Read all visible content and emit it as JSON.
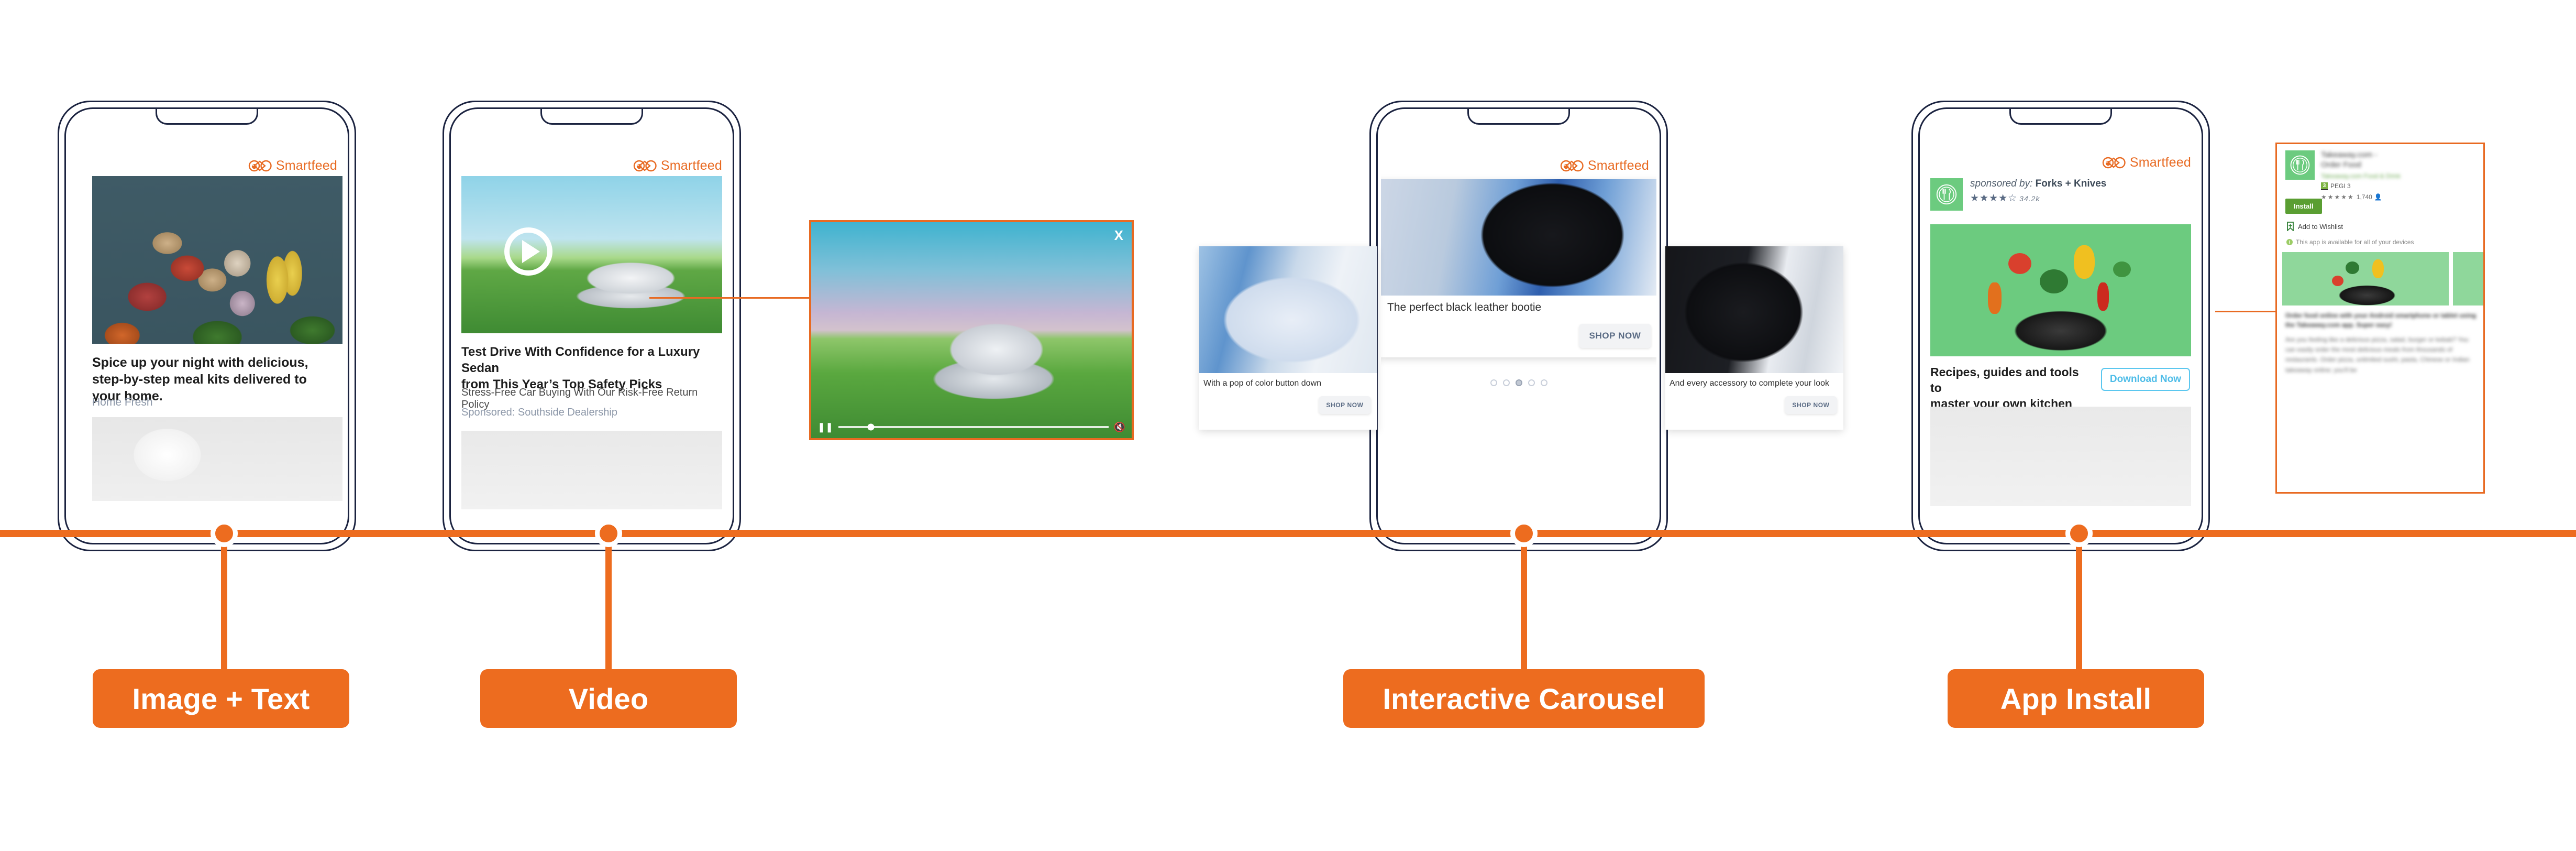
{
  "brand": {
    "logo_text": "Smartfeed",
    "accent": "#ED6C1F"
  },
  "timeline": {
    "labels": [
      {
        "id": "image-text",
        "text": "Image + Text"
      },
      {
        "id": "video",
        "text": "Video"
      },
      {
        "id": "carousel",
        "text": "Interactive Carousel"
      },
      {
        "id": "app-install",
        "text": "App Install"
      }
    ]
  },
  "phone1": {
    "logo": "Smartfeed",
    "title": "Spice up your night with delicious,\nstep-by-step meal kits delivered to your home.",
    "title_line1": "Spice up your night with delicious,",
    "title_line2": "step-by-step meal kits delivered to your home.",
    "brand": "Home Fresh"
  },
  "phone2": {
    "logo": "Smartfeed",
    "title_line1": "Test Drive With Confidence for a Luxury Sedan",
    "title_line2": "from This Year’s Top Safety Picks",
    "subtitle": "Stress-Free Car Buying With Our Risk-Free Return Policy",
    "sponsor": "Sponsored: Southside Dealership",
    "play_icon": "play-icon"
  },
  "video_panel": {
    "close_label": "X",
    "pause_icon": "pause-icon",
    "mute_icon": "mute-icon",
    "progress_percent": 12
  },
  "phone3": {
    "logo": "Smartfeed",
    "cards": [
      {
        "caption": "With a pop of color button down",
        "cta": "SHOP NOW"
      },
      {
        "caption": "The perfect black leather bootie",
        "cta": "SHOP NOW"
      },
      {
        "caption": "And every accessory to complete your look",
        "cta": "SHOP NOW"
      }
    ],
    "dot_count": 5,
    "active_dot": 3
  },
  "phone4": {
    "logo": "Smartfeed",
    "sponsored_prefix": "sponsored by: ",
    "sponsored_by": "Forks + Knives",
    "stars": "★★★★☆",
    "review_count": "34.2k",
    "title_line1": "Recipes, guides and tools to",
    "title_line2": "master your own kitchen",
    "cta": "Download Now",
    "app_icon": "fork-knife-plate-icon"
  },
  "store_panel": {
    "app_name": "Takeaway.com - Order Food",
    "developer": "Takeaway.com   Food & Drink",
    "pegi_badge": "3",
    "pegi_label": "PEGI 3",
    "rating_stars": "★★★★★",
    "rating_count": "1,740",
    "install_label": "Install",
    "wishlist_label": "Add to Wishlist",
    "availability": "This app is available for all of your devices",
    "info_badge": "i",
    "body_heading": "Order food online with your Android smartphone or tablet using the Takeaway.com app. Super easy!",
    "body_text": "Are you feeling like a delicious pizza, salad, burger or kebab? You can easily order the most delicious meals from thousands of restaurants. Order pizza, unlimited sushi, pasta, Chinese or Indian takeaway online; you'll be"
  }
}
